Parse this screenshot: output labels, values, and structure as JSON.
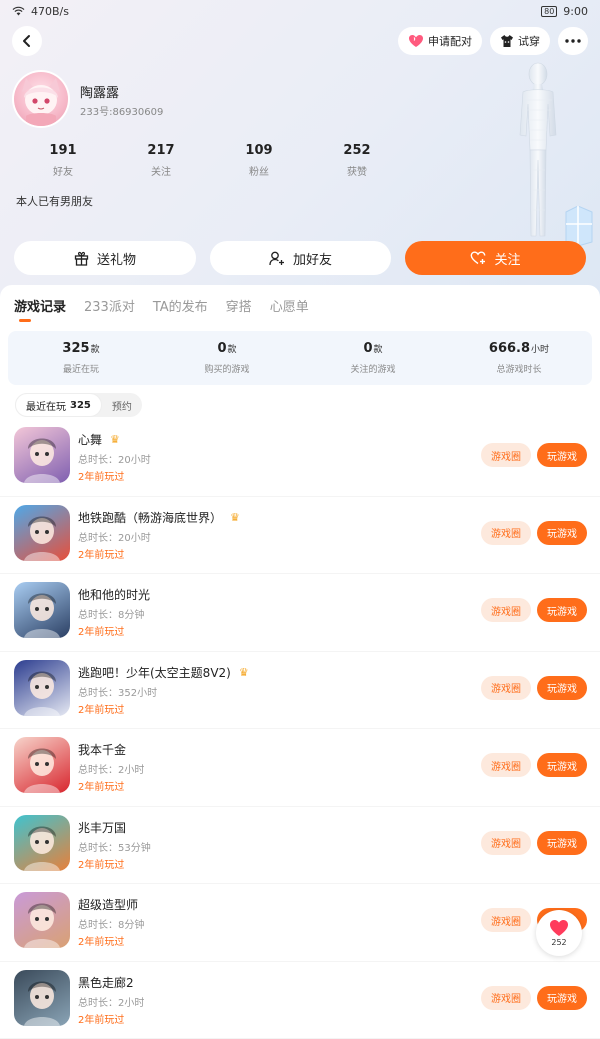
{
  "status": {
    "network_speed": "470B/s",
    "battery": "80",
    "time": "9:00"
  },
  "top_actions": {
    "match_label": "申请配对",
    "try_on_label": "试穿"
  },
  "profile": {
    "nickname": "陶露露",
    "account_id": "233号:86930609",
    "bio": "本人已有男朋友",
    "stats": [
      {
        "value": "191",
        "label": "好友"
      },
      {
        "value": "217",
        "label": "关注"
      },
      {
        "value": "109",
        "label": "粉丝"
      },
      {
        "value": "252",
        "label": "获赞"
      }
    ]
  },
  "actions": {
    "gift_label": "送礼物",
    "add_friend_label": "加好友",
    "follow_label": "关注"
  },
  "tabs": [
    "游戏记录",
    "233派对",
    "TA的发布",
    "穿搭",
    "心愿单"
  ],
  "summary": [
    {
      "value": "325",
      "unit": "款",
      "label": "最近在玩"
    },
    {
      "value": "0",
      "unit": "款",
      "label": "购买的游戏"
    },
    {
      "value": "0",
      "unit": "款",
      "label": "关注的游戏"
    },
    {
      "value": "666.8",
      "unit": "小时",
      "label": "总游戏时长"
    }
  ],
  "filters": {
    "recent_label": "最近在玩",
    "recent_count": "325",
    "reserve_label": "预约"
  },
  "games": [
    {
      "name": "心舞",
      "duration": "总时长：20小时",
      "last_played": "2年前玩过",
      "crown": true,
      "icon_colors": [
        "#f3c7d8",
        "#7f5fb0"
      ]
    },
    {
      "name": "地铁跑酷（畅游海底世界）",
      "duration": "总时长：20小时",
      "last_played": "2年前玩过",
      "crown": true,
      "icon_colors": [
        "#4fa8e8",
        "#e84f3a"
      ]
    },
    {
      "name": "他和他的时光",
      "duration": "总时长：8分钟",
      "last_played": "2年前玩过",
      "crown": false,
      "icon_colors": [
        "#a9cdf2",
        "#2b3f63"
      ]
    },
    {
      "name": "逃跑吧！少年(太空主题8V2)",
      "duration": "总时长：352小时",
      "last_played": "2年前玩过",
      "crown": true,
      "icon_colors": [
        "#2c3d8f",
        "#e6e9f3"
      ]
    },
    {
      "name": "我本千金",
      "duration": "总时长：2小时",
      "last_played": "2年前玩过",
      "crown": false,
      "icon_colors": [
        "#f7d4cb",
        "#d8262e"
      ]
    },
    {
      "name": "兆丰万国",
      "duration": "总时长：53分钟",
      "last_played": "2年前玩过",
      "crown": false,
      "icon_colors": [
        "#3fc3cf",
        "#e8803a"
      ]
    },
    {
      "name": "超级造型师",
      "duration": "总时长：8分钟",
      "last_played": "2年前玩过",
      "crown": false,
      "icon_colors": [
        "#c99ad8",
        "#d9a173"
      ]
    },
    {
      "name": "黑色走廊2",
      "duration": "总时长：2小时",
      "last_played": "2年前玩过",
      "crown": false,
      "icon_colors": [
        "#3a4a5a",
        "#8aa4b6"
      ]
    }
  ],
  "game_buttons": {
    "circle_label": "游戏圈",
    "play_label": "玩游戏"
  },
  "float_like": {
    "count": "252"
  },
  "colors": {
    "accent": "#ff6d1a",
    "accent_light": "#fde9dd",
    "summary_bg": "#f2f6fc"
  }
}
